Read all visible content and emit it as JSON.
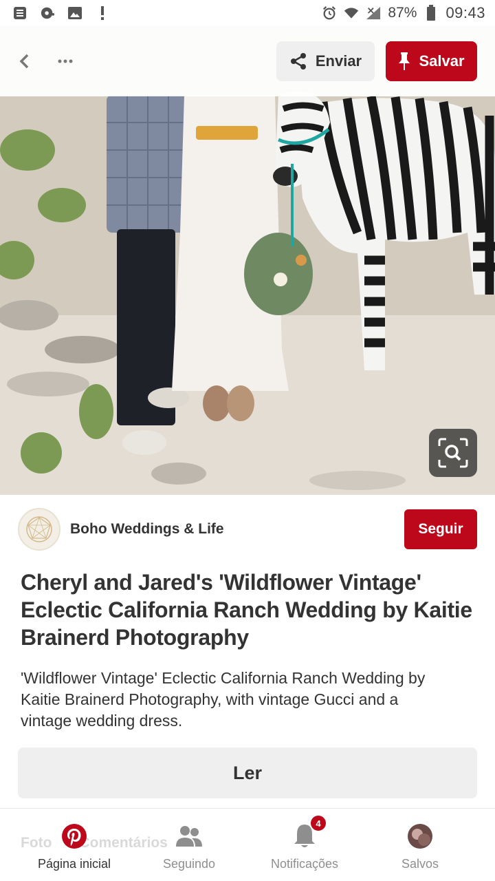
{
  "status_bar": {
    "battery": "87%",
    "time": "09:43",
    "left_icons": [
      "notes-icon",
      "music-disc-icon",
      "image-icon",
      "alert-icon"
    ],
    "right_icons": [
      "alarm-icon",
      "wifi-icon",
      "signal-icon",
      "battery-icon"
    ]
  },
  "header": {
    "back_icon": "chevron-left-icon",
    "more_icon": "more-dots-icon",
    "share_label": "Enviar",
    "save_label": "Salvar"
  },
  "pin": {
    "board_name": "Boho Weddings & Life",
    "follow_label": "Seguir",
    "title": "Cheryl and Jared's 'Wildflower Vintage' Eclectic California Ranch Wedding by Kaitie Brainerd Photography",
    "description": "'Wildflower Vintage' Eclectic California Ranch Wedding by Kaitie Brainerd Photography, with vintage Gucci and a vintage wedding dress.",
    "read_label": "Ler"
  },
  "bottom_nav": {
    "ghost_tabs": [
      "Foto",
      "Comentários"
    ],
    "items": [
      {
        "label": "Página inicial",
        "icon": "pinterest-logo-icon",
        "active": true
      },
      {
        "label": "Seguindo",
        "icon": "people-icon",
        "active": false
      },
      {
        "label": "Notificações",
        "icon": "bell-icon",
        "active": false,
        "badge": "4"
      },
      {
        "label": "Salvos",
        "icon": "profile-avatar-icon",
        "active": false
      }
    ]
  },
  "colors": {
    "brand_red": "#bd081c",
    "button_gray": "#efefef",
    "text_dark": "#333333"
  }
}
